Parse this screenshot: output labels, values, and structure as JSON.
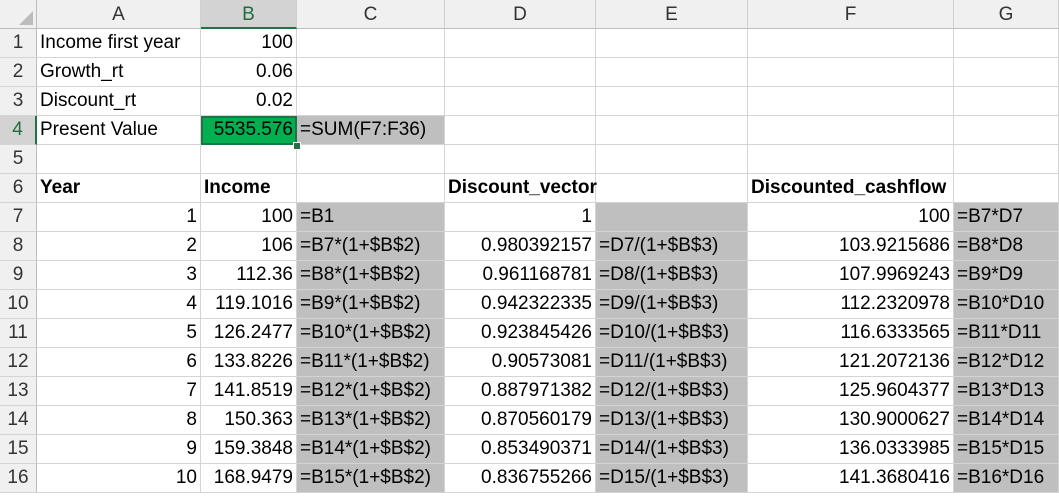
{
  "columns": [
    "A",
    "B",
    "C",
    "D",
    "E",
    "F",
    "G"
  ],
  "selected_column": "B",
  "selected_row": "4",
  "rows": [
    {
      "num": "1",
      "A": "Income first year",
      "B": "100"
    },
    {
      "num": "2",
      "A": "Growth_rt",
      "B": "0.06"
    },
    {
      "num": "3",
      "A": "Discount_rt",
      "B": "0.02"
    },
    {
      "num": "4",
      "A": "Present Value",
      "B": "5535.576",
      "C": "=SUM(F7:F36)"
    },
    {
      "num": "5"
    },
    {
      "num": "6",
      "A": "Year",
      "B": "Income",
      "D": "Discount_vector",
      "F": "Discounted_cashflow"
    },
    {
      "num": "7",
      "A": "1",
      "B": "100",
      "C": "=B1",
      "D": "1",
      "E": "",
      "F": "100",
      "G": "=B7*D7"
    },
    {
      "num": "8",
      "A": "2",
      "B": "106",
      "C": "=B7*(1+$B$2)",
      "D": "0.980392157",
      "E": "=D7/(1+$B$3)",
      "F": "103.9215686",
      "G": "=B8*D8"
    },
    {
      "num": "9",
      "A": "3",
      "B": "112.36",
      "C": "=B8*(1+$B$2)",
      "D": "0.961168781",
      "E": "=D8/(1+$B$3)",
      "F": "107.9969243",
      "G": "=B9*D9"
    },
    {
      "num": "10",
      "A": "4",
      "B": "119.1016",
      "C": "=B9*(1+$B$2)",
      "D": "0.942322335",
      "E": "=D9/(1+$B$3)",
      "F": "112.2320978",
      "G": "=B10*D10"
    },
    {
      "num": "11",
      "A": "5",
      "B": "126.2477",
      "C": "=B10*(1+$B$2)",
      "D": "0.923845426",
      "E": "=D10/(1+$B$3)",
      "F": "116.6333565",
      "G": "=B11*D11"
    },
    {
      "num": "12",
      "A": "6",
      "B": "133.8226",
      "C": "=B11*(1+$B$2)",
      "D": "0.90573081",
      "E": "=D11/(1+$B$3)",
      "F": "121.2072136",
      "G": "=B12*D12"
    },
    {
      "num": "13",
      "A": "7",
      "B": "141.8519",
      "C": "=B12*(1+$B$2)",
      "D": "0.887971382",
      "E": "=D12/(1+$B$3)",
      "F": "125.9604377",
      "G": "=B13*D13"
    },
    {
      "num": "14",
      "A": "8",
      "B": "150.363",
      "C": "=B13*(1+$B$2)",
      "D": "0.870560179",
      "E": "=D13/(1+$B$3)",
      "F": "130.9000627",
      "G": "=B14*D14"
    },
    {
      "num": "15",
      "A": "9",
      "B": "159.3848",
      "C": "=B14*(1+$B$2)",
      "D": "0.853490371",
      "E": "=D14/(1+$B$3)",
      "F": "136.0333985",
      "G": "=B15*D15"
    },
    {
      "num": "16",
      "A": "10",
      "B": "168.9479",
      "C": "=B15*(1+$B$2)",
      "D": "0.836755266",
      "E": "=D15/(1+$B$3)",
      "F": "141.3680416",
      "G": "=B16*D16"
    }
  ],
  "colors": {
    "active_cell_fill": "#00b050",
    "formula_fill": "#bfbfbf",
    "selection_accent": "#217346",
    "header_fill": "#f0f0f0"
  }
}
